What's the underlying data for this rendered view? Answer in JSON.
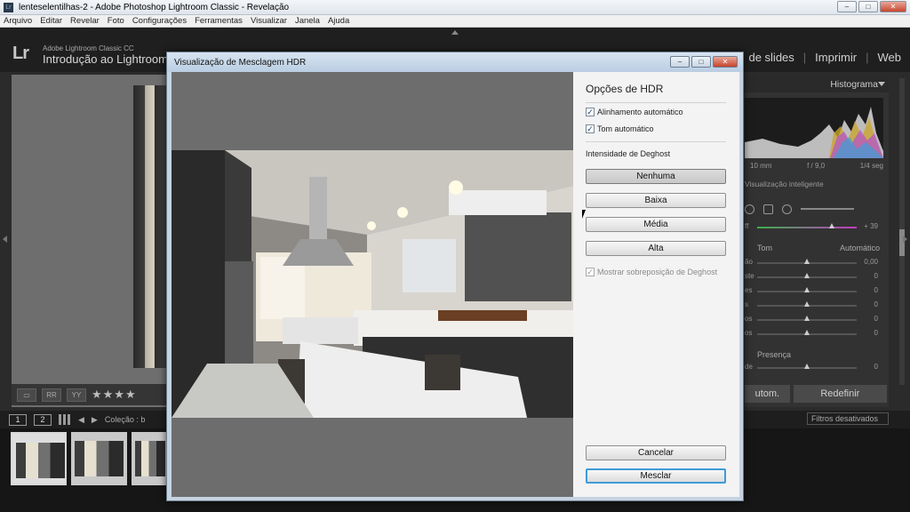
{
  "window": {
    "title": "lenteselentilhas-2 - Adobe Photoshop Lightroom Classic - Revelação",
    "controls": {
      "minimize": "–",
      "maximize": "□",
      "close": "✕"
    }
  },
  "menu": [
    "Arquivo",
    "Editar",
    "Revelar",
    "Foto",
    "Configurações",
    "Ferramentas",
    "Visualizar",
    "Janela",
    "Ajuda"
  ],
  "identity": {
    "logo": "Lr",
    "product": "Adobe Lightroom Classic CC",
    "catalog": "Introdução ao Lightroom"
  },
  "modules": [
    "de slides",
    "Imprimir",
    "Web"
  ],
  "right_panel": {
    "histogram_title": "Histograma",
    "exif": [
      "10 mm",
      "f / 9,0",
      "1/4 seg"
    ],
    "smart_preview": "Visualização inteligente",
    "sliders_top": [
      {
        "label": "ff",
        "value": "+ 39",
        "fill": 0.75
      }
    ],
    "tom_label": "Tom",
    "auto_label": "Automático",
    "sliders": [
      {
        "label": "ão",
        "value": "0,00",
        "fill": 0.5
      },
      {
        "label": "ste",
        "value": "0",
        "fill": 0.5
      },
      {
        "label": "es",
        "value": "0",
        "fill": 0.5
      },
      {
        "label": "s",
        "value": "0",
        "fill": 0.5
      },
      {
        "label": "os",
        "value": "0",
        "fill": 0.5
      },
      {
        "label": "os",
        "value": "0",
        "fill": 0.5
      }
    ],
    "presence_label": "Presença",
    "presence_slider": {
      "label": "de",
      "value": "0",
      "fill": 0.5
    },
    "btn_auto": "utom.",
    "btn_reset": "Redefinir",
    "filters": "Filtros desativados"
  },
  "filmstrip": {
    "page1": "1",
    "page2": "2",
    "collection": "Coleção : b"
  },
  "toolbar": {
    "stars": "★★★★"
  },
  "dialog": {
    "title": "Visualização de Mesclagem HDR",
    "options_heading": "Opções de HDR",
    "auto_align": "Alinhamento automático",
    "auto_tone": "Tom automático",
    "deghost_label": "Intensidade de Deghost",
    "deghost_options": [
      "Nenhuma",
      "Baixa",
      "Média",
      "Alta"
    ],
    "deghost_selected": "Nenhuma",
    "show_overlay": "Mostrar sobreposição de Deghost",
    "cancel": "Cancelar",
    "merge": "Mesclar"
  }
}
